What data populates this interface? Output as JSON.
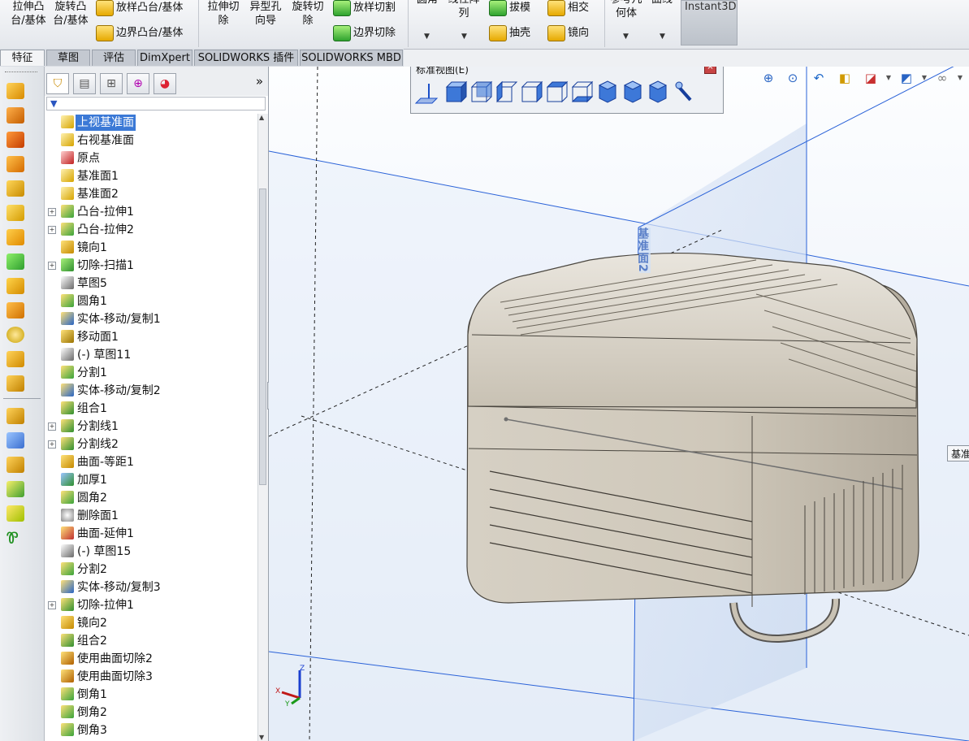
{
  "ribbon": {
    "boss_extrude": "拉伸凸台/基体",
    "revolve_boss": "旋转凸台/基体",
    "loft_boss": "放样凸台/基体",
    "boundary_boss": "边界凸台/基体",
    "extrude_cut": "拉伸切除",
    "hole_wizard": "异型孔向导",
    "revolve_cut": "旋转切除",
    "loft_cut": "放样切割",
    "boundary_cut": "边界切除",
    "fillet": "圆角",
    "linear_pattern": "线性阵列",
    "draft": "拔模",
    "shell": "抽壳",
    "intersect": "相交",
    "mirror": "镜向",
    "ref_geometry": "参考几何体",
    "curves": "曲线",
    "instant3d": "Instant3D"
  },
  "tabs": [
    {
      "label": "特征",
      "active": true
    },
    {
      "label": "草图"
    },
    {
      "label": "评估"
    },
    {
      "label": "DimXpert"
    },
    {
      "label": "SOLIDWORKS 插件"
    },
    {
      "label": "SOLIDWORKS MBD"
    }
  ],
  "feature_manager": {
    "more": "»",
    "tree": [
      {
        "label": "上视基准面",
        "icon": "plane-icon",
        "selected": true
      },
      {
        "label": "右视基准面",
        "icon": "plane-icon"
      },
      {
        "label": "原点",
        "icon": "origin-icon"
      },
      {
        "label": "基准面1",
        "icon": "plane-icon"
      },
      {
        "label": "基准面2",
        "icon": "plane-icon"
      },
      {
        "label": "凸台-拉伸1",
        "icon": "extrude-icon",
        "expandable": true
      },
      {
        "label": "凸台-拉伸2",
        "icon": "extrude-icon",
        "expandable": true
      },
      {
        "label": "镜向1",
        "icon": "mirror-icon"
      },
      {
        "label": "切除-扫描1",
        "icon": "sweep-cut-icon",
        "expandable": true
      },
      {
        "label": "草图5",
        "icon": "sketch-icon"
      },
      {
        "label": "圆角1",
        "icon": "fillet-icon"
      },
      {
        "label": "实体-移动/复制1",
        "icon": "move-body-icon"
      },
      {
        "label": "移动面1",
        "icon": "move-face-icon"
      },
      {
        "label": "(-) 草图11",
        "icon": "sketch-icon"
      },
      {
        "label": "分割1",
        "icon": "split-icon"
      },
      {
        "label": "实体-移动/复制2",
        "icon": "move-body-icon"
      },
      {
        "label": "组合1",
        "icon": "combine-icon"
      },
      {
        "label": "分割线1",
        "icon": "split-line-icon",
        "expandable": true
      },
      {
        "label": "分割线2",
        "icon": "split-line-icon",
        "expandable": true
      },
      {
        "label": "曲面-等距1",
        "icon": "offset-surface-icon"
      },
      {
        "label": "加厚1",
        "icon": "thicken-icon"
      },
      {
        "label": "圆角2",
        "icon": "fillet-icon"
      },
      {
        "label": "删除面1",
        "icon": "delete-face-icon"
      },
      {
        "label": "曲面-延伸1",
        "icon": "extend-surface-icon"
      },
      {
        "label": "(-) 草图15",
        "icon": "sketch-icon"
      },
      {
        "label": "分割2",
        "icon": "split-icon"
      },
      {
        "label": "实体-移动/复制3",
        "icon": "move-body-icon"
      },
      {
        "label": "切除-拉伸1",
        "icon": "extrude-cut-icon",
        "expandable": true
      },
      {
        "label": "镜向2",
        "icon": "mirror-icon"
      },
      {
        "label": "组合2",
        "icon": "combine-icon"
      },
      {
        "label": "使用曲面切除2",
        "icon": "surface-cut-icon"
      },
      {
        "label": "使用曲面切除3",
        "icon": "surface-cut-icon"
      },
      {
        "label": "倒角1",
        "icon": "chamfer-icon"
      },
      {
        "label": "倒角2",
        "icon": "chamfer-icon"
      },
      {
        "label": "倒角3",
        "icon": "chamfer-icon"
      }
    ]
  },
  "standard_views": {
    "title": "标准视图(E)",
    "close": "×"
  },
  "viewport": {
    "plane_label": "基准面2",
    "tooltip": "基准",
    "axes": {
      "x": "X",
      "y": "Y",
      "z": "Z"
    }
  },
  "colors": {
    "accent": "#3b79d6",
    "plane_blue": "#2a62d8",
    "model_fill": "#cdc6b8"
  }
}
